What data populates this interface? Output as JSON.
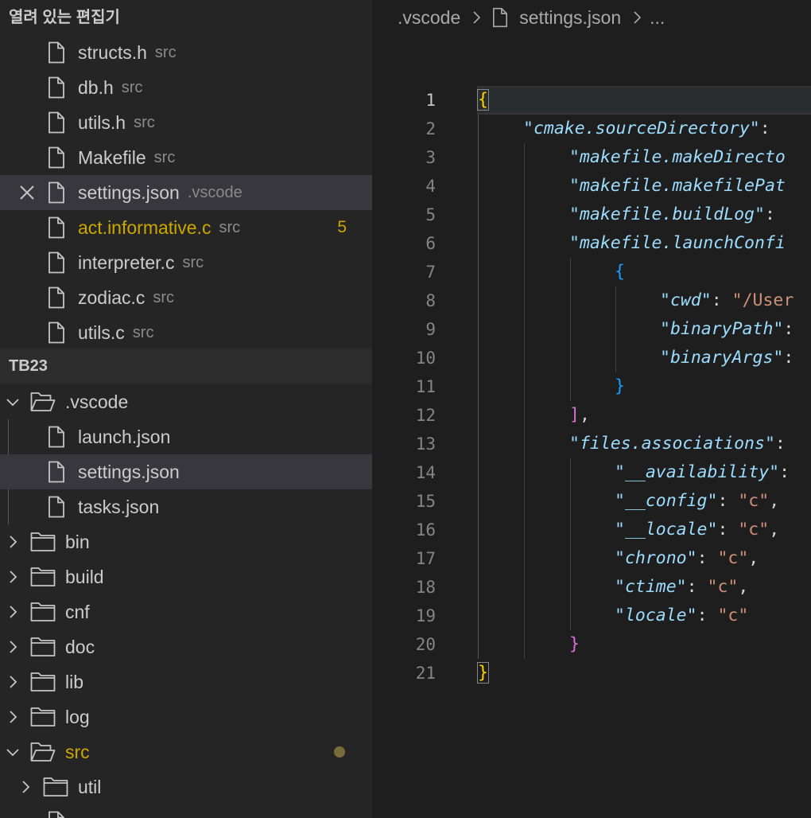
{
  "sidebar": {
    "open_editors_title": "열려 있는 편집기",
    "open_editors": [
      {
        "name": "structs.h",
        "desc": "src"
      },
      {
        "name": "db.h",
        "desc": "src"
      },
      {
        "name": "utils.h",
        "desc": "src"
      },
      {
        "name": "Makefile",
        "desc": "src"
      },
      {
        "name": "settings.json",
        "desc": ".vscode",
        "selected": true
      },
      {
        "name": "act.informative.c",
        "desc": "src",
        "badge": "5",
        "modified": true
      },
      {
        "name": "interpreter.c",
        "desc": "src"
      },
      {
        "name": "zodiac.c",
        "desc": "src"
      },
      {
        "name": "utils.c",
        "desc": "src"
      }
    ],
    "workspace_title": "TB23",
    "tree": [
      {
        "name": ".vscode",
        "type": "folder",
        "expanded": true
      },
      {
        "name": "launch.json",
        "type": "file"
      },
      {
        "name": "settings.json",
        "type": "file",
        "selected": true
      },
      {
        "name": "tasks.json",
        "type": "file"
      },
      {
        "name": "bin",
        "type": "folder"
      },
      {
        "name": "build",
        "type": "folder"
      },
      {
        "name": "cnf",
        "type": "folder"
      },
      {
        "name": "doc",
        "type": "folder"
      },
      {
        "name": "lib",
        "type": "folder"
      },
      {
        "name": "log",
        "type": "folder"
      },
      {
        "name": "src",
        "type": "folder",
        "expanded": true,
        "modified": true
      },
      {
        "name": "util",
        "type": "folder"
      }
    ]
  },
  "editor": {
    "breadcrumb": {
      "folder": ".vscode",
      "file": "settings.json",
      "more": "..."
    },
    "line_numbers": [
      "1",
      "2",
      "3",
      "4",
      "5",
      "6",
      "7",
      "8",
      "9",
      "10",
      "11",
      "12",
      "13",
      "14",
      "15",
      "16",
      "17",
      "18",
      "19",
      "20",
      "21"
    ],
    "tokens": {
      "l2_key": "\"cmake.sourceDirectory\"",
      "l3_key": "\"makefile.makeDirecto",
      "l4_key": "\"makefile.makefilePat",
      "l5_key": "\"makefile.buildLog\"",
      "l6_key": "\"makefile.launchConfi",
      "l8_key": "\"cwd\"",
      "l8_val": "\"/User",
      "l9_key": "\"binaryPath\"",
      "l10_key": "\"binaryArgs\"",
      "l13_key": "\"files.associations\"",
      "l14_key": "\"__availability\"",
      "l15_key": "\"__config\"",
      "l15_val": "\"c\"",
      "l16_key": "\"__locale\"",
      "l16_val": "\"c\"",
      "l17_key": "\"chrono\"",
      "l17_val": "\"c\"",
      "l18_key": "\"ctime\"",
      "l18_val": "\"c\"",
      "l19_key": "\"locale\"",
      "l19_val": "\"c\""
    }
  },
  "colors": {
    "modified": "#cca700",
    "json_key": "#9cdcfe",
    "json_string": "#ce9178"
  }
}
